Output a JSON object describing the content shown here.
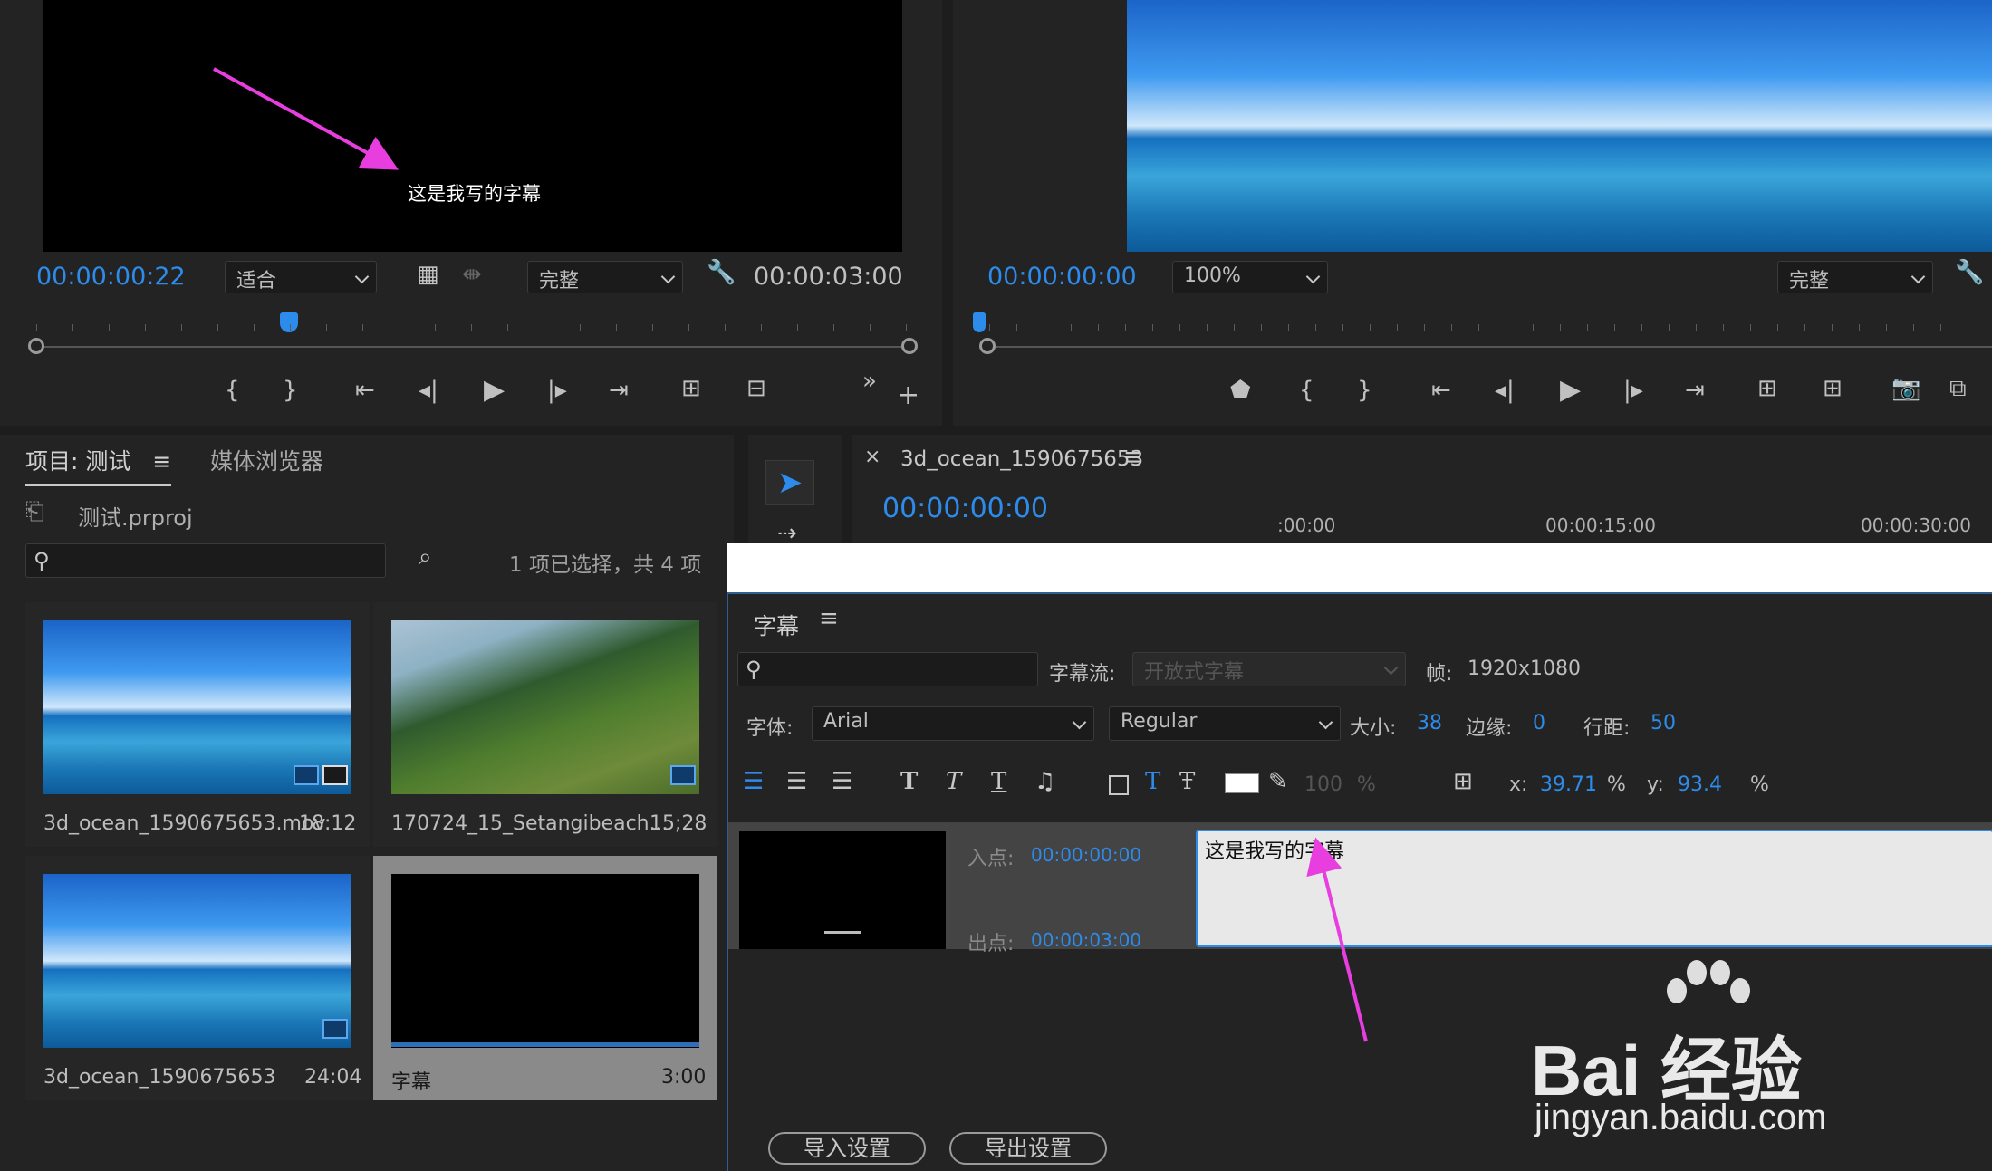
{
  "source_monitor": {
    "subtitle_text": "这是我写的字幕",
    "timecode": "00:00:00:22",
    "fit": "适合",
    "quality": "完整",
    "duration": "00:00:03:00"
  },
  "program_monitor": {
    "timecode": "00:00:00:00",
    "zoom": "100%",
    "quality": "完整"
  },
  "project": {
    "tab_project": "项目: 测试",
    "tab_media": "媒体浏览器",
    "file": "测试.prproj",
    "selection_info": "1 项已选择，共 4 项",
    "items": [
      {
        "name": "3d_ocean_1590675653.mov",
        "duration": "18:12"
      },
      {
        "name": "170724_15_Setangibeach...",
        "duration": "15;28"
      },
      {
        "name": "3d_ocean_1590675653",
        "duration": "24:04"
      },
      {
        "name": "字幕",
        "duration": "3:00"
      }
    ]
  },
  "timeline": {
    "tab_name": "3d_ocean_1590675653",
    "timecode": "00:00:00:00",
    "ruler": [
      ":00:00",
      "00:00:15:00",
      "00:00:30:00"
    ]
  },
  "captions": {
    "title": "字幕",
    "stream_label": "字幕流:",
    "stream_value": "开放式字幕",
    "frame_label": "帧:",
    "frame_value": "1920x1080",
    "font_label": "字体:",
    "font_value": "Arial",
    "style_value": "Regular",
    "size_label": "大小:",
    "size_value": "38",
    "edge_label": "边缘:",
    "edge_value": "0",
    "leading_label": "行距:",
    "leading_value": "50",
    "opacity_value": "100",
    "opacity_unit": "%",
    "x_label": "x:",
    "x_value": "39.71",
    "y_label": "y:",
    "y_value": "93.4",
    "pct": "%",
    "in_label": "入点:",
    "in_value": "00:00:00:00",
    "out_label": "出点:",
    "out_value": "00:00:03:00",
    "caption_text": "这是我写的字幕",
    "import_btn": "导入设置",
    "export_btn": "导出设置"
  },
  "watermark": {
    "brand": "Bai 经验",
    "url": "jingyan.baidu.com"
  },
  "colors": {
    "accent": "#2d8ceb",
    "annotation": "#e83ee0"
  }
}
